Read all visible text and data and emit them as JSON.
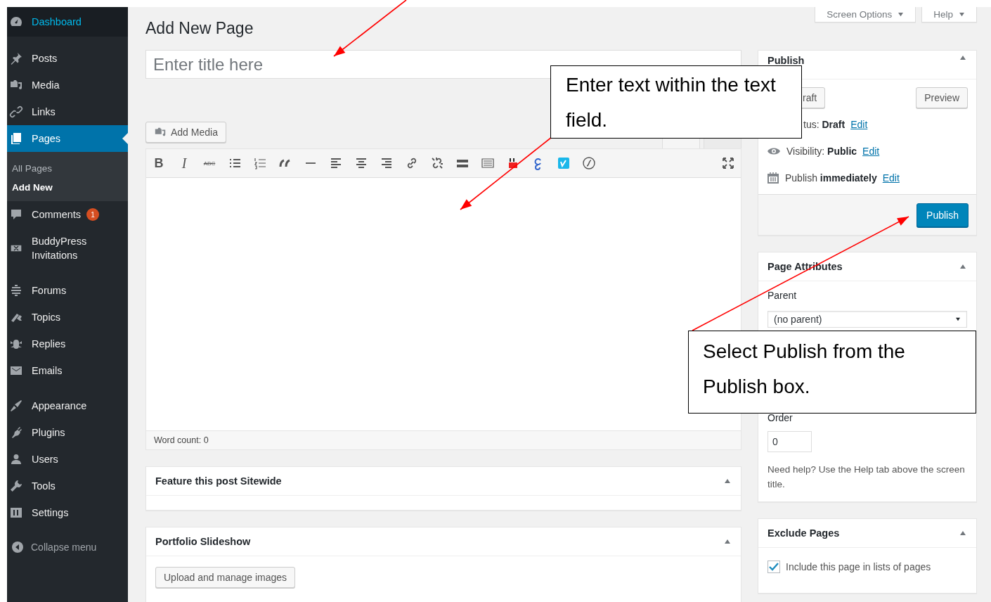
{
  "sidebar": {
    "groups": [
      [
        {
          "label": "Dashboard",
          "selected": false
        }
      ],
      [
        {
          "label": "Posts",
          "selected": false
        },
        {
          "label": "Media",
          "selected": false
        },
        {
          "label": "Links",
          "selected": false
        },
        {
          "label": "Pages",
          "selected": true,
          "children": [
            {
              "label": "All Pages",
              "selected": false
            },
            {
              "label": "Add New",
              "selected": true
            }
          ]
        },
        {
          "label": "Comments",
          "selected": false,
          "badge": "1"
        },
        {
          "label": "BuddyPress Invitations",
          "selected": false
        }
      ],
      [
        {
          "label": "Forums",
          "selected": false
        },
        {
          "label": "Topics",
          "selected": false
        },
        {
          "label": "Replies",
          "selected": false
        },
        {
          "label": "Emails",
          "selected": false
        }
      ],
      [
        {
          "label": "Appearance",
          "selected": false
        },
        {
          "label": "Plugins",
          "selected": false
        },
        {
          "label": "Users",
          "selected": false
        },
        {
          "label": "Tools",
          "selected": false
        },
        {
          "label": "Settings",
          "selected": false
        }
      ]
    ],
    "collapse": "Collapse menu"
  },
  "header": {
    "title": "Add New Page",
    "screen_options": "Screen Options",
    "help": "Help"
  },
  "editor": {
    "title_placeholder": "Enter title here",
    "add_media": "Add Media",
    "toolbar": [
      {
        "kind": "bold",
        "label": "B"
      },
      {
        "kind": "italic",
        "label": "I"
      },
      {
        "kind": "strike",
        "label": "ABC"
      },
      {
        "kind": "icon"
      },
      {
        "kind": "icon"
      },
      {
        "kind": "icon"
      },
      {
        "kind": "icon"
      },
      {
        "kind": "icon"
      },
      {
        "kind": "icon"
      },
      {
        "kind": "icon"
      },
      {
        "kind": "icon"
      },
      {
        "kind": "icon"
      },
      {
        "kind": "icon"
      },
      {
        "kind": "icon"
      },
      {
        "kind": "icon"
      },
      {
        "kind": "icon"
      },
      {
        "kind": "icon"
      },
      {
        "kind": "icon"
      }
    ],
    "word_count": "Word count: 0"
  },
  "boxes": [
    {
      "title": "Feature this post Sitewide"
    },
    {
      "title": "Portfolio Slideshow",
      "button": "Upload and manage images"
    }
  ],
  "publish": {
    "title": "Publish",
    "save_draft": "raft",
    "preview": "Preview",
    "status": "tus: **Draft**",
    "visibility": "Visibility: **Public**",
    "schedule": "Publish **immediately**",
    "status_edit": "Edit",
    "visibility_edit": "Edit",
    "schedule_edit": "Edit",
    "publish_button": "Publish"
  },
  "page_attributes": {
    "title": "Page Attributes",
    "parent_label": "Parent",
    "parent_value": "(no parent)",
    "order_label": "Order",
    "order_value": "0",
    "help": "Need help? Use the Help tab above the screen title."
  },
  "exclude_pages": {
    "title": "Exclude Pages",
    "checkbox_label": "Include this page in lists of pages",
    "checked": true
  },
  "callouts": [
    {
      "text": "Enter text within the text field."
    },
    {
      "text": "Select Publish from the Publish box."
    }
  ]
}
